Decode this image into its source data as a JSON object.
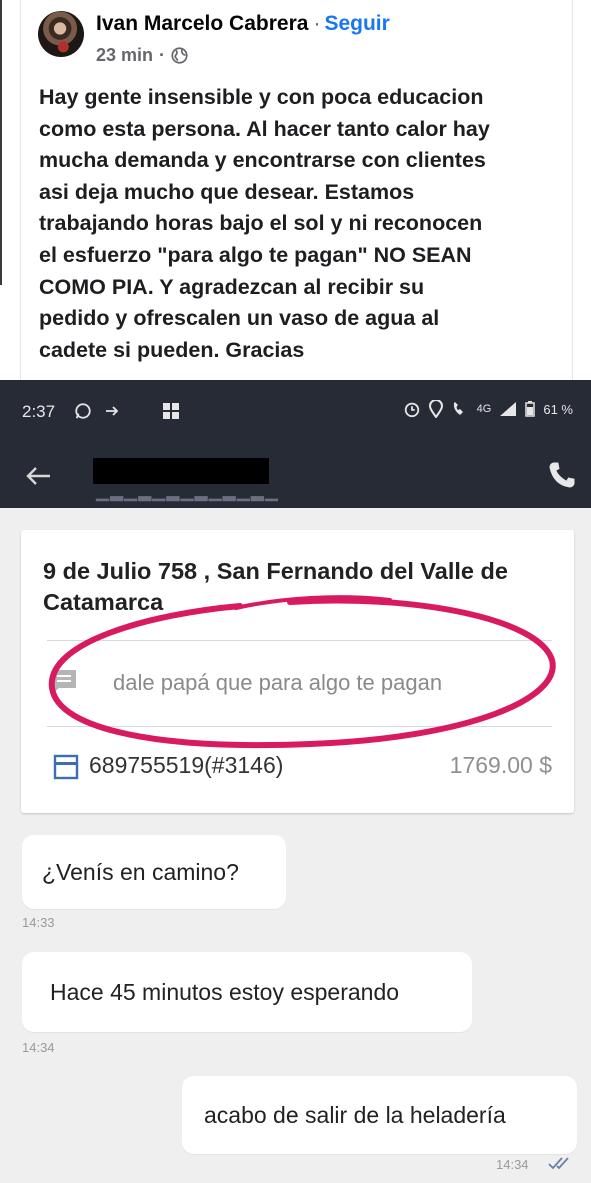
{
  "post": {
    "author": "Ivan Marcelo Cabrera",
    "separator": "·",
    "follow_label": "Seguir",
    "time": "23 min",
    "time_separator": "·",
    "privacy_icon": "globe-icon",
    "text_lines": [
      "Hay gente insensible y con poca educacion",
      "como esta persona. Al hacer tanto calor hay",
      "mucha demanda y encontrarse con clientes",
      "asi deja mucho que desear. Estamos",
      "trabajando horas bajo el sol y ni reconocen",
      "el esfuerzo \"para algo te pagan\" NO SEAN",
      "COMO PIA. Y agradezcan al recibir su",
      "pedido y ofrescalen un vaso de agua al",
      "cadete si pueden. Gracias"
    ]
  },
  "phone": {
    "status_time": "2:37",
    "network": "4G",
    "battery": "61 %",
    "order": {
      "address": "9 de Julio 758 , San Fernando del Valle de Catamarca",
      "note": "dale papá que para algo te pagan",
      "order_id": "689755519(#3146)",
      "amount": "1769.00 $"
    },
    "messages": [
      {
        "text": "¿Venís en camino?",
        "time": "14:33",
        "direction": "incoming"
      },
      {
        "text": "Hace 45 minutos estoy esperando",
        "time": "14:34",
        "direction": "incoming"
      },
      {
        "text": "acabo de salir de la heladería",
        "time": "14:34",
        "direction": "outgoing"
      }
    ],
    "colors": {
      "appbar": "#262b36",
      "highlight_circle": "#d81b60",
      "background": "#efefef"
    }
  }
}
